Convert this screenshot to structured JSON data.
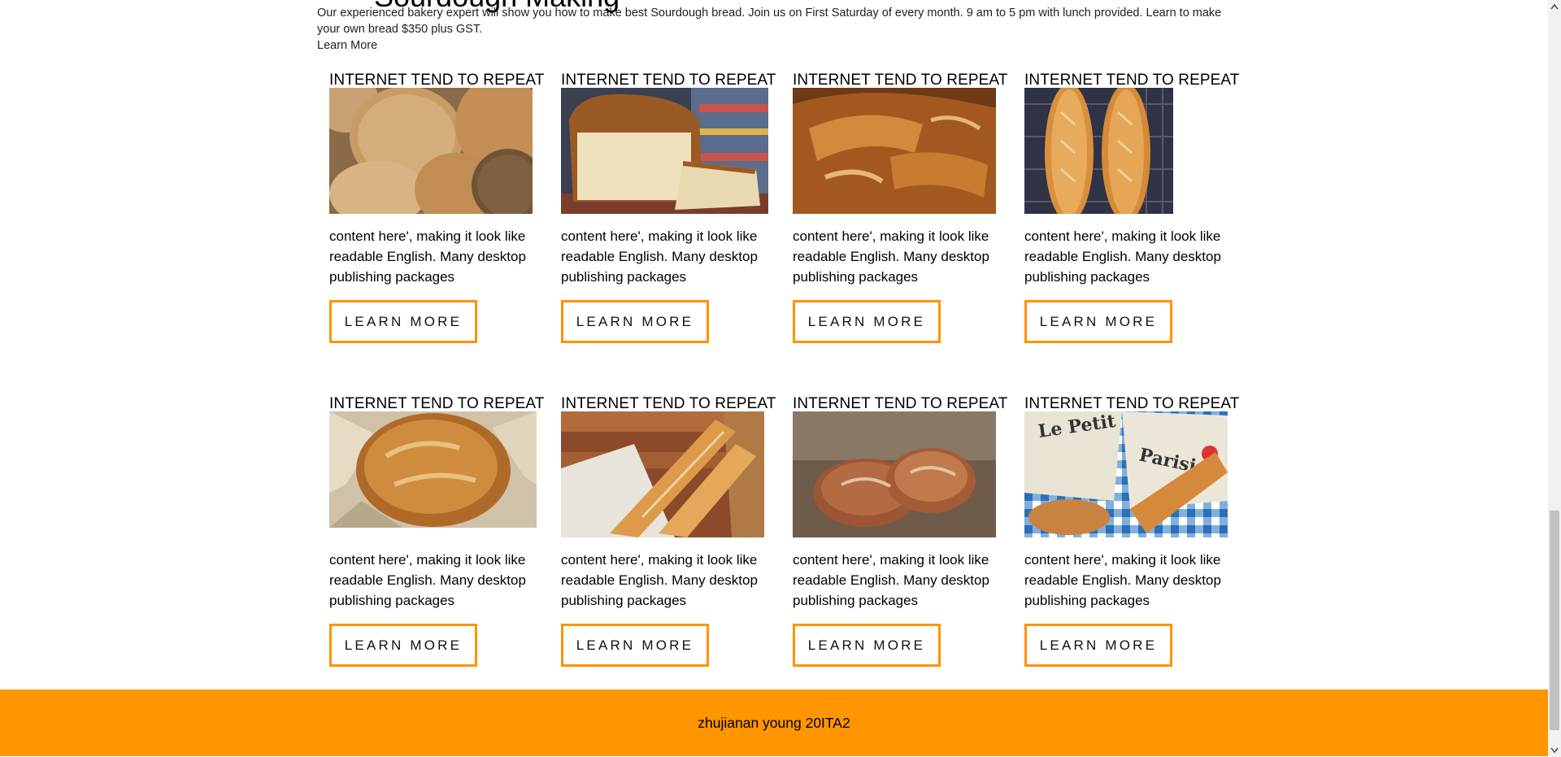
{
  "intro": {
    "cut_heading": "Sourdough Making",
    "text": "Our experienced bakery expert will show you how to make best Sourdough bread. Join us on First Saturday of every month. 9 am to 5 pm with lunch provided. Learn to make your own bread $350 plus GST.",
    "link": "Learn More"
  },
  "cards": [
    {
      "title": "INTERNET TEND TO REPEAT",
      "text": "content here', making it look like readable English. Many desktop publishing packages",
      "button": "LEARN MORE",
      "image": "bread-rolls-image"
    },
    {
      "title": "INTERNET TEND TO REPEAT",
      "text": "content here', making it look like readable English. Many desktop publishing packages",
      "button": "LEARN MORE",
      "image": "sliced-loaf-image"
    },
    {
      "title": "INTERNET TEND TO REPEAT",
      "text": "content here', making it look like readable English. Many desktop publishing packages",
      "button": "LEARN MORE",
      "image": "rustic-loaf-image"
    },
    {
      "title": "INTERNET TEND TO REPEAT",
      "text": "content here', making it look like readable English. Many desktop publishing packages",
      "button": "LEARN MORE",
      "image": "baguettes-on-rack-image"
    },
    {
      "title": "INTERNET TEND TO REPEAT",
      "text": "content here', making it look like readable English. Many desktop publishing packages",
      "button": "LEARN MORE",
      "image": "round-loaf-image"
    },
    {
      "title": "INTERNET TEND TO REPEAT",
      "text": "content here', making it look like readable English. Many desktop publishing packages",
      "button": "LEARN MORE",
      "image": "baguettes-in-basket-image"
    },
    {
      "title": "INTERNET TEND TO REPEAT",
      "text": "content here', making it look like readable English. Many desktop publishing packages",
      "button": "LEARN MORE",
      "image": "sourdough-loaves-image"
    },
    {
      "title": "INTERNET TEND TO REPEAT",
      "text": "content here', making it look like readable English. Many desktop publishing packages",
      "button": "LEARN MORE",
      "image": "baguette-newspaper-image"
    }
  ],
  "footer": {
    "text": "zhujianan young 20ITA2"
  },
  "colors": {
    "accent": "#ff9600",
    "button_border": "#ff9300"
  }
}
